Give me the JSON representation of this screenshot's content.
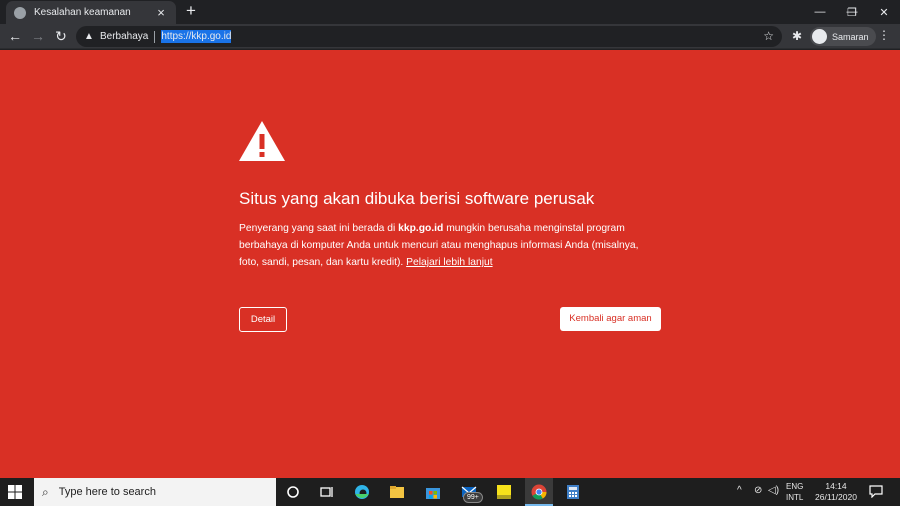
{
  "browser": {
    "tab_title": "Kesalahan keamanan",
    "tab_close": "×",
    "new_tab": "+",
    "window_controls": {
      "minimize": "—",
      "restore": "❐",
      "close": "✕"
    },
    "nav": {
      "back": "←",
      "forward": "→",
      "reload": "↻"
    },
    "omnibox": {
      "security_label": "Berbahaya",
      "url": "https://kkp.go.id"
    },
    "profile_name": "Samaran",
    "menu": "⋮",
    "bookmark_star": "☆",
    "extensions": "✱"
  },
  "interstitial": {
    "heading": "Situs yang akan dibuka berisi software perusak",
    "para_before": "Penyerang yang saat ini berada di ",
    "para_site": "kkp.go.id",
    "para_after": " mungkin berusaha menginstal program berbahaya di komputer Anda untuk mencuri atau menghapus informasi Anda (misalnya, foto, sandi, pesan, dan kartu kredit). ",
    "learn_more": "Pelajari lebih lanjut",
    "details_button": "Detail",
    "back_button": "Kembali agar aman",
    "background_color": "#d93025"
  },
  "taskbar": {
    "search_placeholder": "Type here to search",
    "badge_count": "99+",
    "language": {
      "line1": "ENG",
      "line2": "INTL"
    },
    "time": "14:14",
    "date": "26/11/2020",
    "tray": {
      "chevron": "^",
      "network": "⊘",
      "volume": "◁)"
    }
  }
}
